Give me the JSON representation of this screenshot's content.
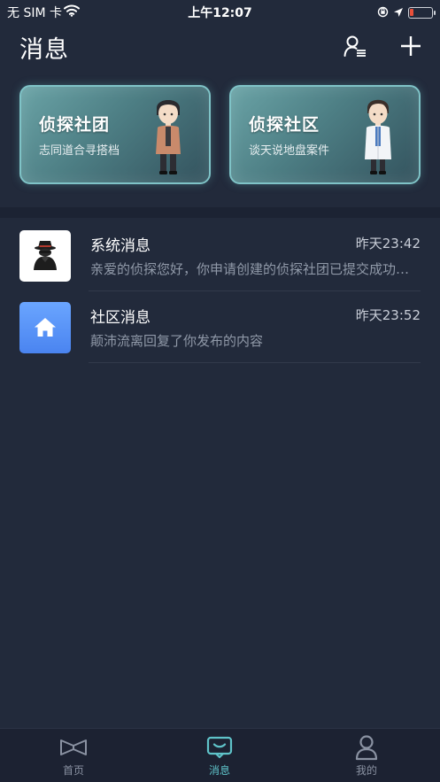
{
  "status_bar": {
    "carrier": "无 SIM 卡",
    "time": "上午12:07"
  },
  "header": {
    "title": "消息",
    "icons": [
      "contacts-icon",
      "add-icon"
    ]
  },
  "cards": [
    {
      "title": "侦探社团",
      "subtitle": "志同道合寻搭档",
      "icon": "detective-figure-casual"
    },
    {
      "title": "侦探社区",
      "subtitle": "谈天说地盘案件",
      "icon": "detective-figure-labcoat"
    }
  ],
  "messages": [
    {
      "name": "系统消息",
      "time": "昨天23:42",
      "preview": "亲爱的侦探您好，你申请创建的侦探社团已提交成功，请耐心等待审核",
      "icon": "detective-avatar"
    },
    {
      "name": "社区消息",
      "time": "昨天23:52",
      "preview": "颠沛流离回复了你发布的内容",
      "icon": "home-icon"
    }
  ],
  "tabs": [
    {
      "label": "首页",
      "icon": "home-tab-icon",
      "active": false
    },
    {
      "label": "消息",
      "icon": "message-tab-icon",
      "active": true
    },
    {
      "label": "我的",
      "icon": "profile-tab-icon",
      "active": false
    }
  ],
  "colors": {
    "background": "#222a3b",
    "accent": "#5fc3c9",
    "battery_low": "#e8503a",
    "home_avatar": "#4a84f0"
  }
}
